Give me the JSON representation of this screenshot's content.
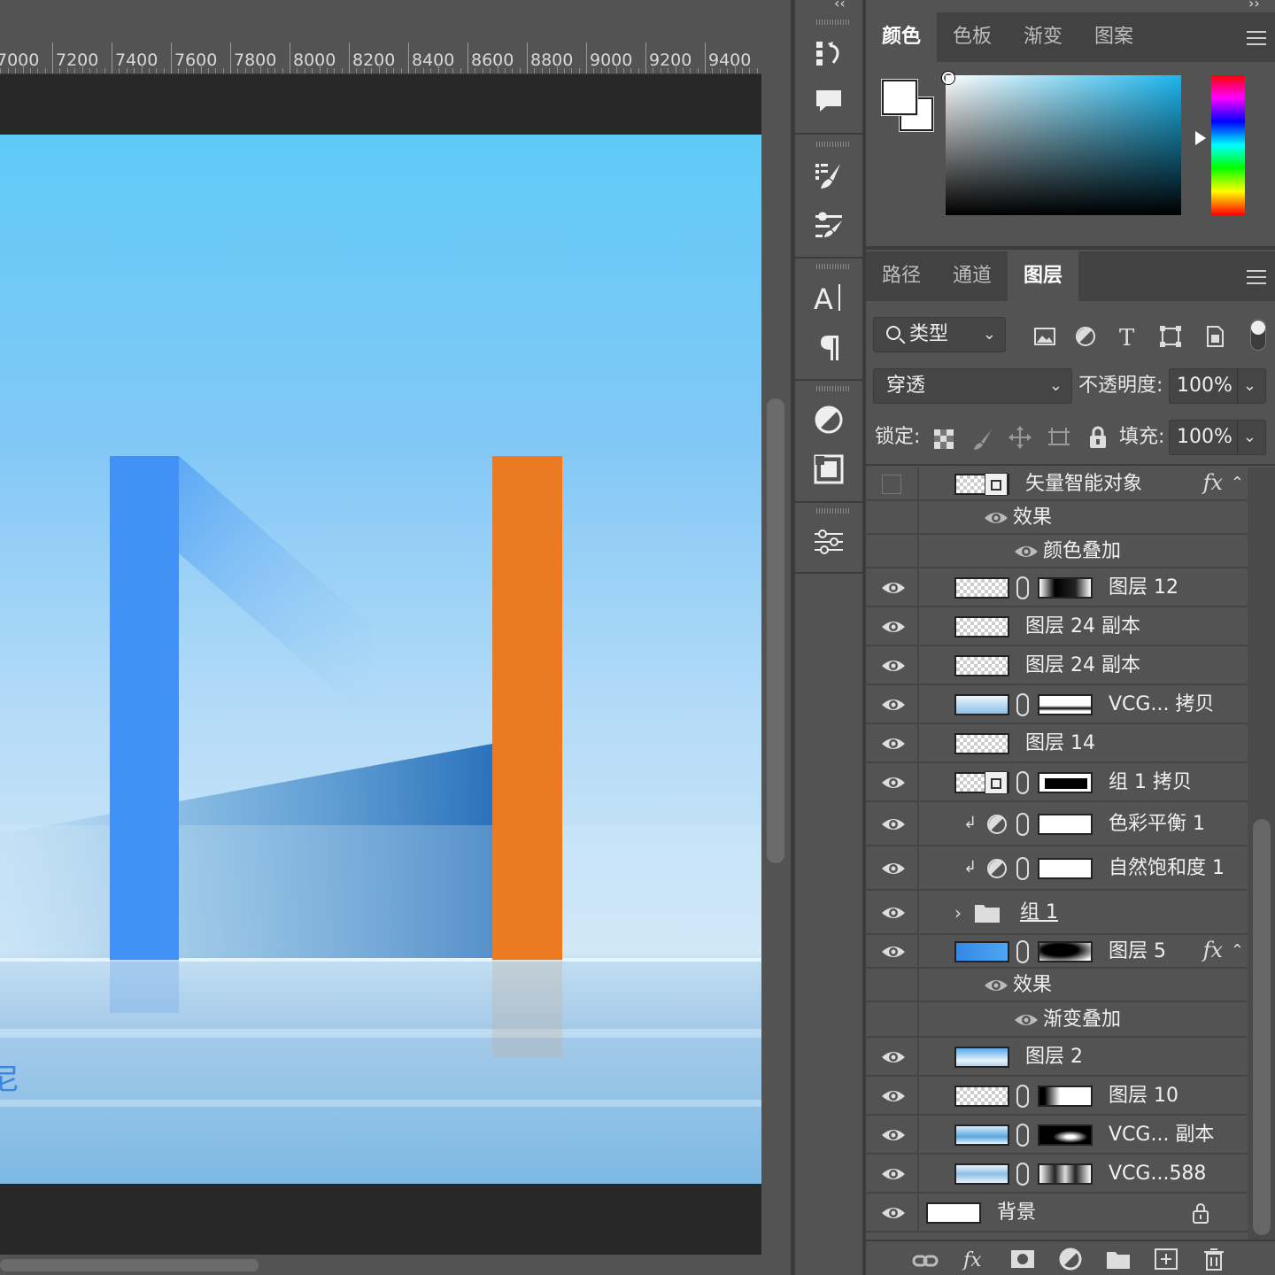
{
  "ruler": {
    "labels": [
      "7000",
      "7200",
      "7400",
      "7600",
      "7800",
      "8000",
      "8200",
      "8400",
      "8600",
      "8800",
      "9000",
      "9200",
      "9400"
    ]
  },
  "canvas": {
    "partial_text": "尼"
  },
  "tools": [
    {
      "name": "history-icon"
    },
    {
      "name": "comment-icon"
    },
    {
      "name": "brush-settings-icon"
    },
    {
      "name": "tool-presets-icon"
    },
    {
      "name": "character-icon"
    },
    {
      "name": "paragraph-icon"
    },
    {
      "name": "adjustments-icon"
    },
    {
      "name": "libraries-icon"
    },
    {
      "name": "properties-icon"
    }
  ],
  "color_panel": {
    "tabs": [
      "颜色",
      "色板",
      "渐变",
      "图案"
    ],
    "active_tab": "颜色",
    "fg_color": "#ffffff",
    "bg_color": "#ffffff",
    "hue_color": "#1cb6ee"
  },
  "layers_panel": {
    "tabs": [
      "路径",
      "通道",
      "图层"
    ],
    "active_tab": "图层",
    "filter_label": "类型",
    "blend_mode": "穿透",
    "opacity_label": "不透明度:",
    "opacity_value": "100%",
    "lock_label": "锁定:",
    "fill_label": "填充:",
    "fill_value": "100%",
    "layers": [
      {
        "name": "矢量智能对象",
        "visible": false,
        "fx": true,
        "thumb": "checker",
        "smart": true,
        "mask": false
      },
      {
        "name": "效果",
        "sub": 1
      },
      {
        "name": "颜色叠加",
        "sub": 2
      },
      {
        "name": "图层 12",
        "visible": true,
        "thumb": "checker-dark",
        "mask": "dark-gradient"
      },
      {
        "name": "图层 24 副本",
        "visible": true,
        "thumb": "checker"
      },
      {
        "name": "图层 24 副本",
        "visible": true,
        "thumb": "checker"
      },
      {
        "name": "VCG... 拷贝",
        "visible": true,
        "thumb": "sky",
        "mask": "white-dark-bottom"
      },
      {
        "name": "图层 14",
        "visible": true,
        "thumb": "checker"
      },
      {
        "name": "组 1 拷贝",
        "visible": true,
        "thumb": "checker",
        "smart": true,
        "mask": "black-box"
      },
      {
        "name": "色彩平衡 1",
        "visible": true,
        "adjust": true,
        "mask": "white"
      },
      {
        "name": "自然饱和度 1",
        "visible": true,
        "adjust": true,
        "mask": "white"
      },
      {
        "name": "组 1",
        "visible": true,
        "group": true
      },
      {
        "name": "图层 5",
        "visible": true,
        "fx": true,
        "thumb": "blue",
        "mask": "radial"
      },
      {
        "name": "效果",
        "sub": 1
      },
      {
        "name": "渐变叠加",
        "sub": 2
      },
      {
        "name": "图层 2",
        "visible": true,
        "thumb": "sky-light"
      },
      {
        "name": "图层 10",
        "visible": true,
        "thumb": "checker-blue",
        "mask": "white-left-dark"
      },
      {
        "name": "VCG... 副本",
        "visible": true,
        "thumb": "sky2",
        "mask": "black-blob"
      },
      {
        "name": "VCG...588",
        "visible": true,
        "thumb": "sky3",
        "mask": "gray-band"
      },
      {
        "name": "背景",
        "visible": true,
        "thumb": "white",
        "locked": true
      }
    ]
  }
}
